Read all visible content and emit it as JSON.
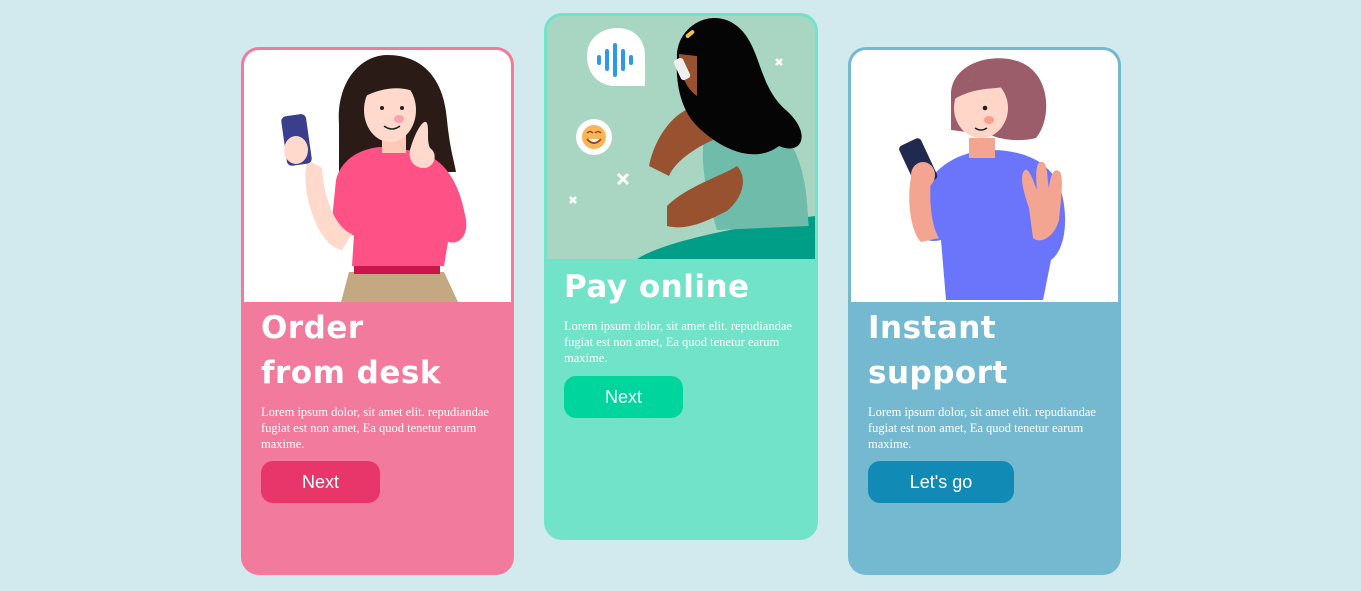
{
  "cards": [
    {
      "title_line1": "Order",
      "title_line2": "from desk",
      "body": "Lorem ipsum dolor, sit amet elit. repudiandae fugiat est non amet, Ea quod tenetur earum maxime.",
      "button_label": "Next",
      "accent_color": "#f27a9c",
      "button_color": "#e8356a"
    },
    {
      "title_line1": "Pay online",
      "body": "Lorem ipsum dolor, sit amet elit. repudiandae fugiat est non amet, Ea quod tenetur earum maxime.",
      "button_label": "Next",
      "accent_color": "#70e3c9",
      "button_color": "#00d59e"
    },
    {
      "title_line1": "Instant",
      "title_line2": "support",
      "body": "Lorem ipsum dolor, sit amet elit. repudiandae fugiat est non amet, Ea quod tenetur earum maxime.",
      "button_label": "Let's go",
      "accent_color": "#75b9d1",
      "button_color": "#118ab5"
    }
  ],
  "icons": {
    "card1_illustration": "woman-with-phone-illustration",
    "card2_illustration": "woman-on-phone-call-illustration",
    "card3_illustration": "woman-waving-with-phone-illustration",
    "voice_bubble": "voice-wave-icon",
    "emoji": "smile-emoji-icon"
  }
}
